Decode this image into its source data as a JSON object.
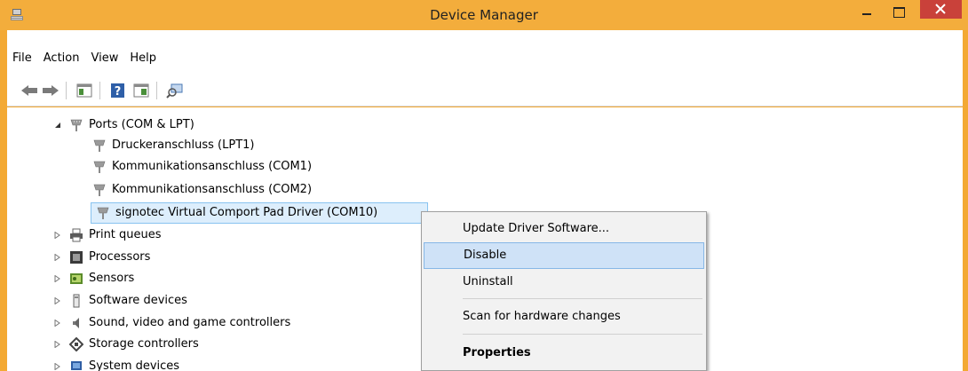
{
  "window": {
    "title": "Device Manager"
  },
  "menu": {
    "items": [
      "File",
      "Action",
      "View",
      "Help"
    ]
  },
  "tree": {
    "ports": {
      "label": "Ports (COM & LPT)",
      "children": [
        "Druckeranschluss (LPT1)",
        "Kommunikationsanschluss (COM1)",
        "Kommunikationsanschluss (COM2)",
        "signotec Virtual Comport Pad Driver (COM10)"
      ]
    },
    "categories": [
      {
        "label": "Print queues",
        "icon": "printer-icon"
      },
      {
        "label": "Processors",
        "icon": "processor-icon"
      },
      {
        "label": "Sensors",
        "icon": "sensor-icon"
      },
      {
        "label": "Software devices",
        "icon": "software-device-icon"
      },
      {
        "label": "Sound, video and game controllers",
        "icon": "speaker-icon"
      },
      {
        "label": "Storage controllers",
        "icon": "storage-controller-icon"
      },
      {
        "label": "System devices",
        "icon": "system-device-icon"
      }
    ]
  },
  "context_menu": {
    "items": [
      "Update Driver Software...",
      "Disable",
      "Uninstall",
      "Scan for hardware changes",
      "Properties"
    ],
    "highlighted": "Disable"
  },
  "colors": {
    "titlebar": "#f3ad3c",
    "close_button": "#c9413a",
    "selection": "#ddeefc",
    "menu_highlight": "#cfe2f7"
  }
}
